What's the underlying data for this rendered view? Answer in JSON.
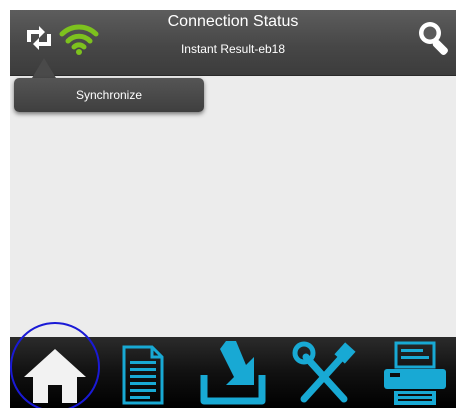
{
  "header": {
    "title": "Connection Status",
    "subtitle": "Instant Result-eb18"
  },
  "tooltip": {
    "label": "Synchronize"
  },
  "icons": {
    "sync": "sync-icon",
    "wifi": "wifi-icon",
    "search": "search-icon",
    "home": "home-icon",
    "document": "document-icon",
    "download": "download-icon",
    "tools": "tools-icon",
    "printer": "printer-icon"
  },
  "colors": {
    "header_bg": "#474747",
    "wifi_green": "#7dc21e",
    "accent_cyan": "#18a9d4",
    "home_white": "#f2f2f2",
    "highlight_blue": "#1a1ad6"
  }
}
